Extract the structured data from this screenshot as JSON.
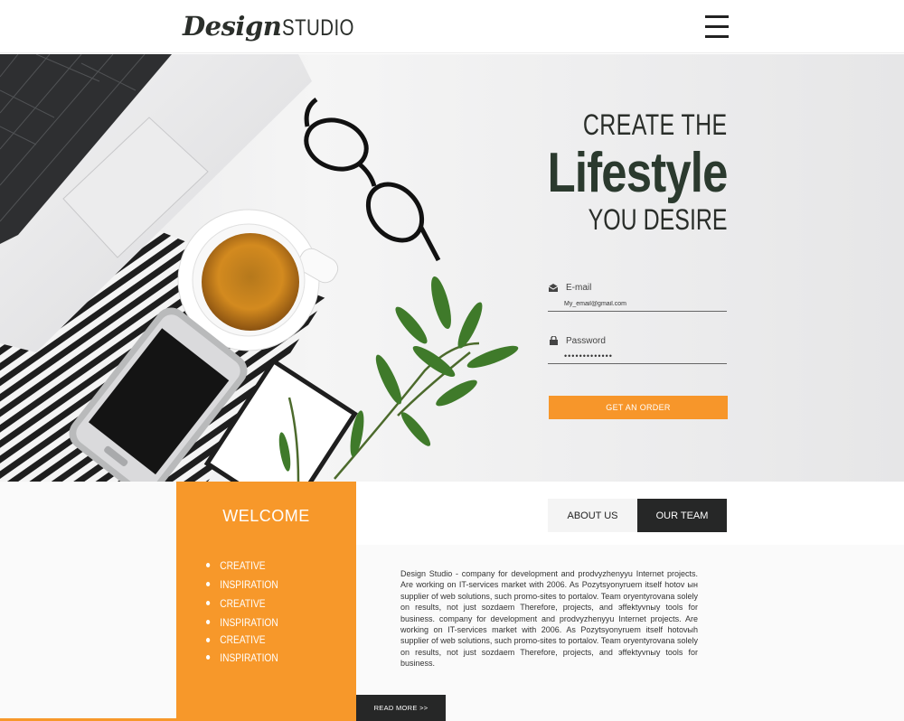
{
  "header": {
    "logo_script": "Design",
    "logo_caps": "STUDIO"
  },
  "hero": {
    "headline_1": "CREATE THE",
    "headline_2": "Lifestyle",
    "headline_3": "YOU DESIRE",
    "email": {
      "label": "E-mail",
      "icon": "envelope-icon",
      "value": "My_email@gmail.com"
    },
    "password": {
      "label": "Password",
      "icon": "lock-icon",
      "value": "•••••••••••••"
    },
    "order_button": "GET AN ORDER"
  },
  "welcome": {
    "title": "WELCOME",
    "items": [
      "CREATIVE",
      "INSPIRATION",
      "CREATIVE",
      "INSPIRATION",
      "CREATIVE",
      "INSPIRATION"
    ]
  },
  "tabs": {
    "about": "ABOUT US",
    "team": "OUR TEAM",
    "active": "OUR TEAM"
  },
  "about_text": "Design Studio - company for development and prodvyzhenyyu Internet projects. Are working on IT-services market with 2006. As Pozytsyonyruem itself hotov ын supplier of web solutions, such promo-sites to portalov. Team oryentyrovana solely on results, not just sozdaem Therefore, projects, and эffektyvnыy tools for business. company for development and prodvyzhenyyu Internet projects. Are working on IT-services market with 2006. As Pozytsyonyruem itself hotovыh supplier of web solutions, such promo-sites to portalov. Team oryentyrovana solely on results, not just sozdaem Therefore, projects, and эffektyvnыy tools for business.",
  "read_more": "READ MORE >>",
  "colors": {
    "accent": "#f7982a",
    "dark": "#262727",
    "headline": "#2b3a2e"
  }
}
